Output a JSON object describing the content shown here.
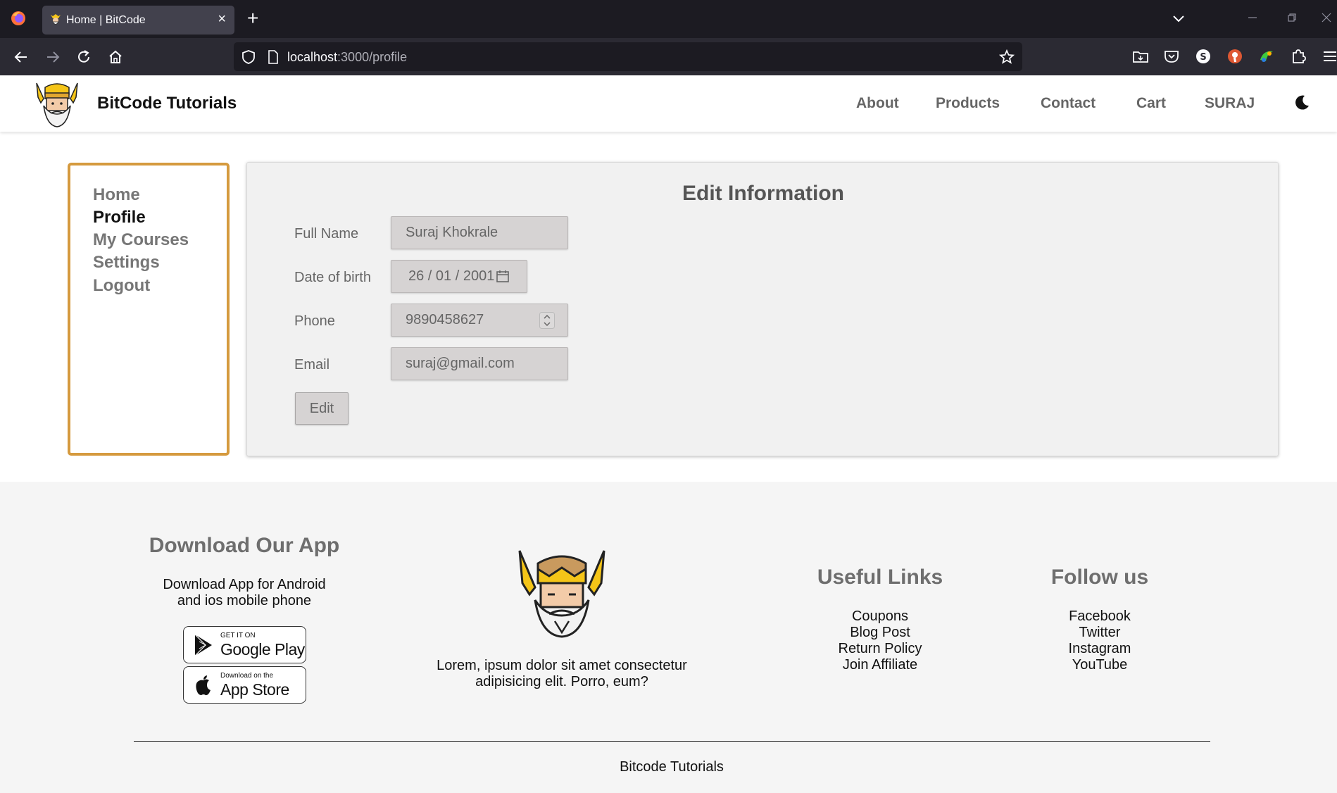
{
  "browser": {
    "tab_title": "Home | BitCode",
    "url_host": "localhost",
    "url_path": ":3000/profile"
  },
  "header": {
    "brand": "BitCode Tutorials",
    "nav": [
      "About",
      "Products",
      "Contact",
      "Cart",
      "SURAJ"
    ],
    "theme_icon": "moon-icon"
  },
  "sidebar": {
    "items": [
      "Home",
      "Profile",
      "My Courses",
      "Settings",
      "Logout"
    ],
    "active": "Profile"
  },
  "form": {
    "title": "Edit Information",
    "fields": [
      {
        "label": "Full Name",
        "value": "Suraj Khokrale"
      },
      {
        "label": "Date of birth",
        "value": "26 / 01 / 2001"
      },
      {
        "label": "Phone",
        "value": "9890458627"
      },
      {
        "label": "Email",
        "value": "suraj@gmail.com"
      }
    ],
    "edit_label": "Edit"
  },
  "footer": {
    "download": {
      "heading": "Download Our App",
      "text_line1": "Download App for Android",
      "text_line2": "and ios mobile phone",
      "google_small": "GET IT ON",
      "google_big": "Google Play",
      "apple_small": "Download on the",
      "apple_big": "App Store"
    },
    "about": {
      "text_line1": "Lorem, ipsum dolor sit amet consectetur",
      "text_line2": "adipisicing elit. Porro, eum?"
    },
    "useful": {
      "heading": "Useful Links",
      "links": [
        "Coupons",
        "Blog Post",
        "Return Policy",
        "Join Affiliate"
      ]
    },
    "follow": {
      "heading": "Follow us",
      "links": [
        "Facebook",
        "Twitter",
        "Instagram",
        "YouTube"
      ]
    },
    "copyright": "Bitcode Tutorials"
  },
  "colors": {
    "sidebar_border": "#d59a3e",
    "card_bg": "#f1f1f1",
    "input_bg": "#d6d3d3",
    "footer_bg": "#f5f5f5"
  }
}
